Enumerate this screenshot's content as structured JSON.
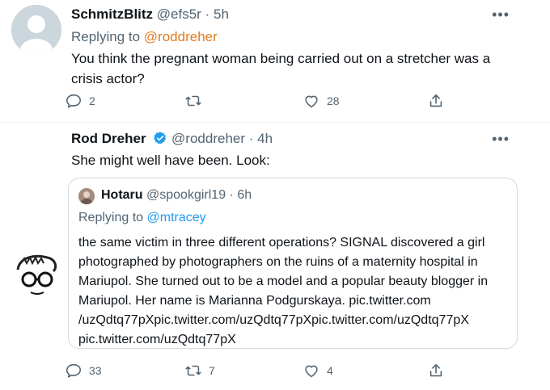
{
  "tweet1": {
    "display_name": "SchmitzBlitz",
    "handle": "@efs5r",
    "separator": "·",
    "time": "5h",
    "replying_label": "Replying to",
    "replying_to": "@roddreher",
    "text": "You think the pregnant woman being carried out on a stretcher was a crisis actor?",
    "reply_count": "2",
    "retweet_count": "",
    "like_count": "28",
    "more": "•••"
  },
  "tweet2": {
    "display_name": "Rod Dreher",
    "handle": "@roddreher",
    "separator": "·",
    "time": "4h",
    "text": "She might well have been. Look:",
    "reply_count": "33",
    "retweet_count": "7",
    "like_count": "4",
    "more": "•••",
    "quote": {
      "display_name": "Hotaru",
      "handle": "@spookgirl19",
      "separator": "·",
      "time": "6h",
      "replying_label": "Replying to",
      "replying_to": "@mtracey",
      "text_lines": [
        "the same victim in three different operations?  SIGNAL discovered a girl",
        "photographed by photographers on the ruins of a maternity hospital in",
        "Mariupol.  She turned out to be a model and a popular beauty blogger in",
        "Mariupol.  Her name is Marianna Podgurskaya. pic.twitter.com",
        "/uzQdtq77pXpic.twitter.com/uzQdtq77pXpic.twitter.com/uzQdtq77pX",
        "pic.twitter.com/uzQdtq77pX"
      ]
    }
  },
  "colors": {
    "accent": "#1d9bf0",
    "muted": "#536471",
    "mention_orange": "#e07b23",
    "verified": "#1d9bf0"
  },
  "icons": [
    "reply-icon",
    "retweet-icon",
    "like-icon",
    "share-icon",
    "verified-badge-icon",
    "more-icon"
  ]
}
